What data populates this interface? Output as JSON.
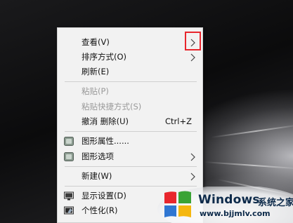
{
  "context_menu": {
    "items": [
      {
        "label": "查看(V)",
        "submenu": true,
        "enabled": true
      },
      {
        "label": "排序方式(O)",
        "submenu": true,
        "enabled": true
      },
      {
        "label": "刷新(E)",
        "submenu": false,
        "enabled": true
      },
      {
        "label": "粘贴(P)",
        "submenu": false,
        "enabled": false
      },
      {
        "label": "粘贴快捷方式(S)",
        "submenu": false,
        "enabled": false
      },
      {
        "label": "撤消 删除(U)",
        "shortcut": "Ctrl+Z",
        "submenu": false,
        "enabled": true
      },
      {
        "label": "图形属性......",
        "icon": "graphics-properties-icon",
        "submenu": false,
        "enabled": true
      },
      {
        "label": "图形选项",
        "icon": "graphics-options-icon",
        "submenu": true,
        "enabled": true
      },
      {
        "label": "新建(W)",
        "submenu": true,
        "enabled": true
      },
      {
        "label": "显示设置(D)",
        "icon": "display-settings-icon",
        "submenu": false,
        "enabled": true
      },
      {
        "label": "个性化(R)",
        "icon": "personalize-icon",
        "submenu": false,
        "enabled": true
      }
    ]
  },
  "watermark": {
    "brand": "Windows",
    "site_name": "系统之家",
    "url": "www.bjjmlv.com"
  },
  "colors": {
    "menu_background": "#f2f2f2",
    "disabled_text": "#9a9a9a",
    "highlight_border": "#e8262d",
    "watermark_text": "#0d2a4a"
  }
}
